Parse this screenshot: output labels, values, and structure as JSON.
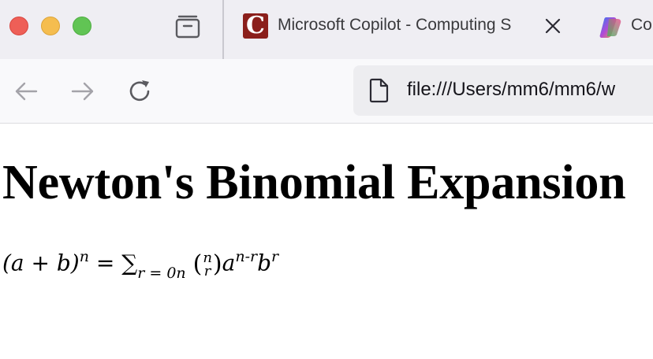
{
  "tab_active": {
    "favicon_letter": "C",
    "title": "Microsoft Copilot - Computing S"
  },
  "tab_next": {
    "title": "Co"
  },
  "address_bar": {
    "url": "file:///Users/mm6/mm6/w"
  },
  "page": {
    "title": "Newton's Binomial Expansion",
    "formula": {
      "lhs_base": "(a + b)",
      "lhs_exp": "n",
      "equals": "=",
      "sum": "∑",
      "sum_sub": "r = 0n",
      "binom_top": "n",
      "binom_bottom": "r",
      "a": "a",
      "a_exp": "n-r",
      "b": "b",
      "b_exp": "r"
    }
  },
  "icons": {
    "close": "close-window",
    "minimize": "minimize-window",
    "maximize": "maximize-window",
    "tabs": "tab-overview-icon",
    "back": "back-arrow-icon",
    "forward": "forward-arrow-icon",
    "reload": "reload-icon",
    "page": "page-icon"
  },
  "colors": {
    "traffic_close": "#ee5f57",
    "traffic_min": "#f5bd4f",
    "traffic_max": "#61c454",
    "favicon_bg": "#8b1f1b"
  }
}
